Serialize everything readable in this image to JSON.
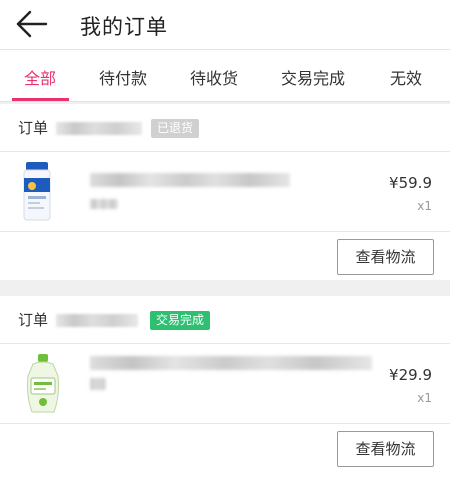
{
  "header": {
    "title": "我的订单"
  },
  "tabs": [
    {
      "label": "全部",
      "active": true
    },
    {
      "label": "待付款",
      "active": false
    },
    {
      "label": "待收货",
      "active": false
    },
    {
      "label": "交易完成",
      "active": false
    },
    {
      "label": "无效",
      "active": false
    }
  ],
  "orders": [
    {
      "order_label": "订单",
      "status": "已退货",
      "status_color": "#d0d0d0",
      "product_image": "sunscreen-bottle-icon",
      "price": "¥59.9",
      "quantity": "x1",
      "action_label": "查看物流"
    },
    {
      "order_label": "订单",
      "status": "交易完成",
      "status_color": "#2fbf71",
      "product_image": "lotion-bottle-icon",
      "price": "¥29.9",
      "quantity": "x1",
      "action_label": "查看物流"
    }
  ],
  "colors": {
    "accent": "#e8336e",
    "background": "#f0f0f0",
    "success": "#2fbf71"
  }
}
